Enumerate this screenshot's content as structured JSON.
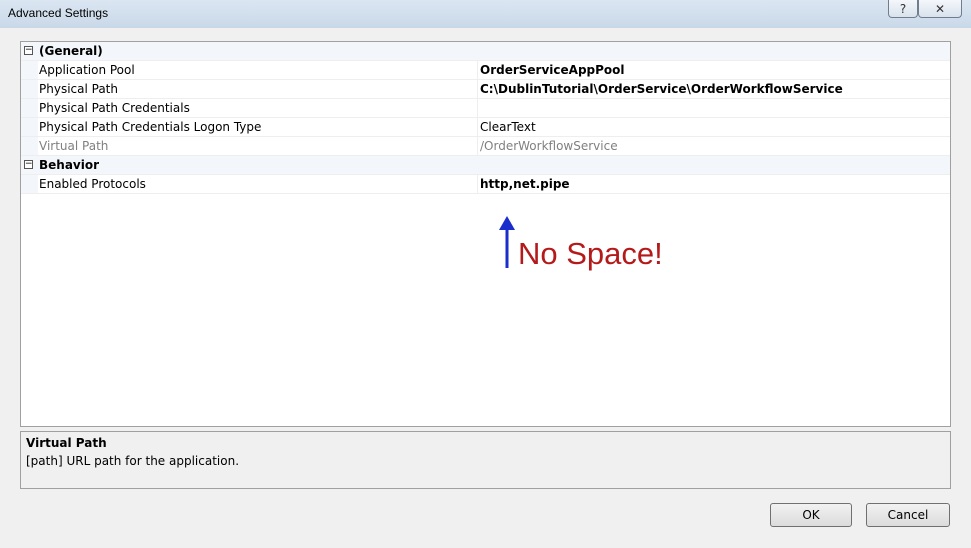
{
  "window": {
    "title": "Advanced Settings",
    "help_label": "?",
    "close_label": "✕"
  },
  "grid": {
    "categories": [
      {
        "label": "(General)",
        "toggle": "−",
        "properties": [
          {
            "name": "Application Pool",
            "value": "OrderServiceAppPool",
            "bold": true
          },
          {
            "name": "Physical Path",
            "value": "C:\\DublinTutorial\\OrderService\\OrderWorkflowService",
            "bold": true
          },
          {
            "name": "Physical Path Credentials",
            "value": ""
          },
          {
            "name": "Physical Path Credentials Logon Type",
            "value": "ClearText"
          },
          {
            "name": "Virtual Path",
            "value": "/OrderWorkflowService",
            "disabled": true
          }
        ]
      },
      {
        "label": "Behavior",
        "toggle": "−",
        "properties": [
          {
            "name": "Enabled Protocols",
            "value": "http,net.pipe",
            "bold": true
          }
        ]
      }
    ]
  },
  "annotation": {
    "text": "No Space!",
    "arrow_color": "#1a2ecc",
    "text_color": "#b51a1a"
  },
  "description": {
    "title": "Virtual Path",
    "text": "[path] URL path for the application."
  },
  "buttons": {
    "ok": "OK",
    "cancel": "Cancel"
  }
}
